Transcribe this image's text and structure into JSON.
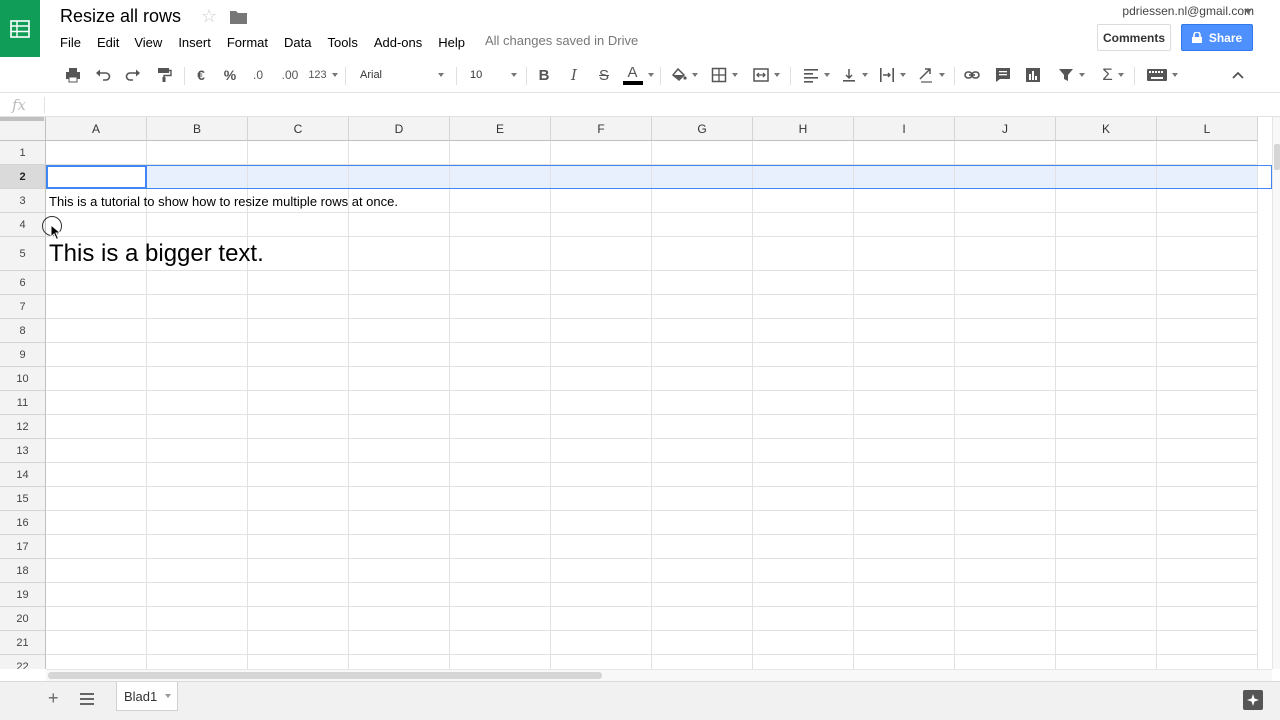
{
  "app": {
    "title": "Resize all rows",
    "save_status": "All changes saved in Drive",
    "account": "pdriessen.nl@gmail.com",
    "brand_color": "#0f9d58"
  },
  "menu": [
    "File",
    "Edit",
    "View",
    "Insert",
    "Format",
    "Data",
    "Tools",
    "Add-ons",
    "Help"
  ],
  "buttons": {
    "comments": "Comments",
    "share": "Share"
  },
  "toolbar": {
    "currency": "€",
    "percent": "%",
    "decrease_decimals": ".0",
    "increase_decimals": ".00",
    "more_formats": "123",
    "font": "Arial",
    "font_size": "10",
    "text_color": "#000000"
  },
  "formula_bar": {
    "label": "fx",
    "value": ""
  },
  "columns": [
    "A",
    "B",
    "C",
    "D",
    "E",
    "F",
    "G",
    "H",
    "I",
    "J",
    "K",
    "L"
  ],
  "rows": [
    "1",
    "2",
    "3",
    "4",
    "5",
    "6",
    "7",
    "8",
    "9",
    "10",
    "11",
    "12",
    "13",
    "14",
    "15",
    "16",
    "17",
    "18",
    "19",
    "20",
    "21",
    "22"
  ],
  "selected_row": "2",
  "cells": {
    "A3": "This is a tutorial to show how to resize multiple rows at once.",
    "A5": "This is a bigger text."
  },
  "sheets": [
    "Blad1"
  ]
}
